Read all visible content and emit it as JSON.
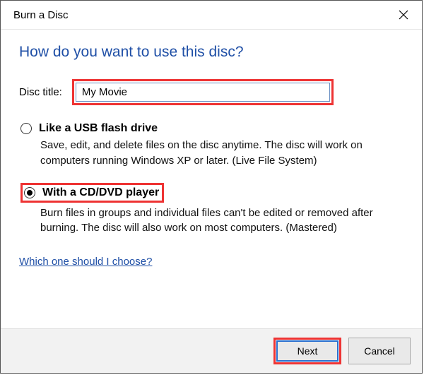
{
  "window": {
    "title": "Burn a Disc"
  },
  "heading": "How do you want to use this disc?",
  "field": {
    "label": "Disc title:",
    "value": "My Movie"
  },
  "options": {
    "usb": {
      "title": "Like a USB flash drive",
      "desc": "Save, edit, and delete files on the disc anytime. The disc will work on computers running Windows XP or later. (Live File System)"
    },
    "cddvd": {
      "title": "With a CD/DVD player",
      "desc": "Burn files in groups and individual files can't be edited or removed after burning. The disc will also work on most computers. (Mastered)"
    }
  },
  "help_link": "Which one should I choose?",
  "buttons": {
    "next": "Next",
    "cancel": "Cancel"
  }
}
